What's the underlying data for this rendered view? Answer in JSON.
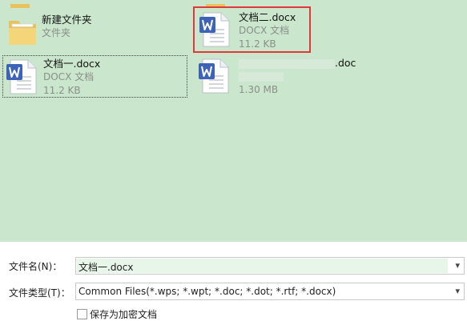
{
  "files": [
    {
      "id": "folder",
      "name": "新建文件夹",
      "type": "文件夹",
      "size": "",
      "icon": "folder-icon"
    },
    {
      "id": "doc2",
      "name": "文档二.docx",
      "type": "DOCX 文档",
      "size": "11.2 KB",
      "icon": "word-doc-icon"
    },
    {
      "id": "doc1",
      "name": "文档一.docx",
      "type": "DOCX 文档",
      "size": "11.2 KB",
      "icon": "word-doc-icon"
    },
    {
      "id": "doc-blurred",
      "name": ".doc",
      "type": "",
      "size": "1.30 MB",
      "icon": "word-doc-icon"
    }
  ],
  "form": {
    "filename_label": "文件名(N)：",
    "filename_value": "文档一.docx",
    "filetype_label": "文件类型(T)：",
    "filetype_value": "Common Files(*.wps; *.wpt; *.doc; *.dot; *.rtf; *.docx)",
    "encrypt_label": "保存为加密文档"
  },
  "colors": {
    "pane_bg": "#cae6cc",
    "selection_red": "#e1393b",
    "word_blue": "#3d63b8"
  }
}
